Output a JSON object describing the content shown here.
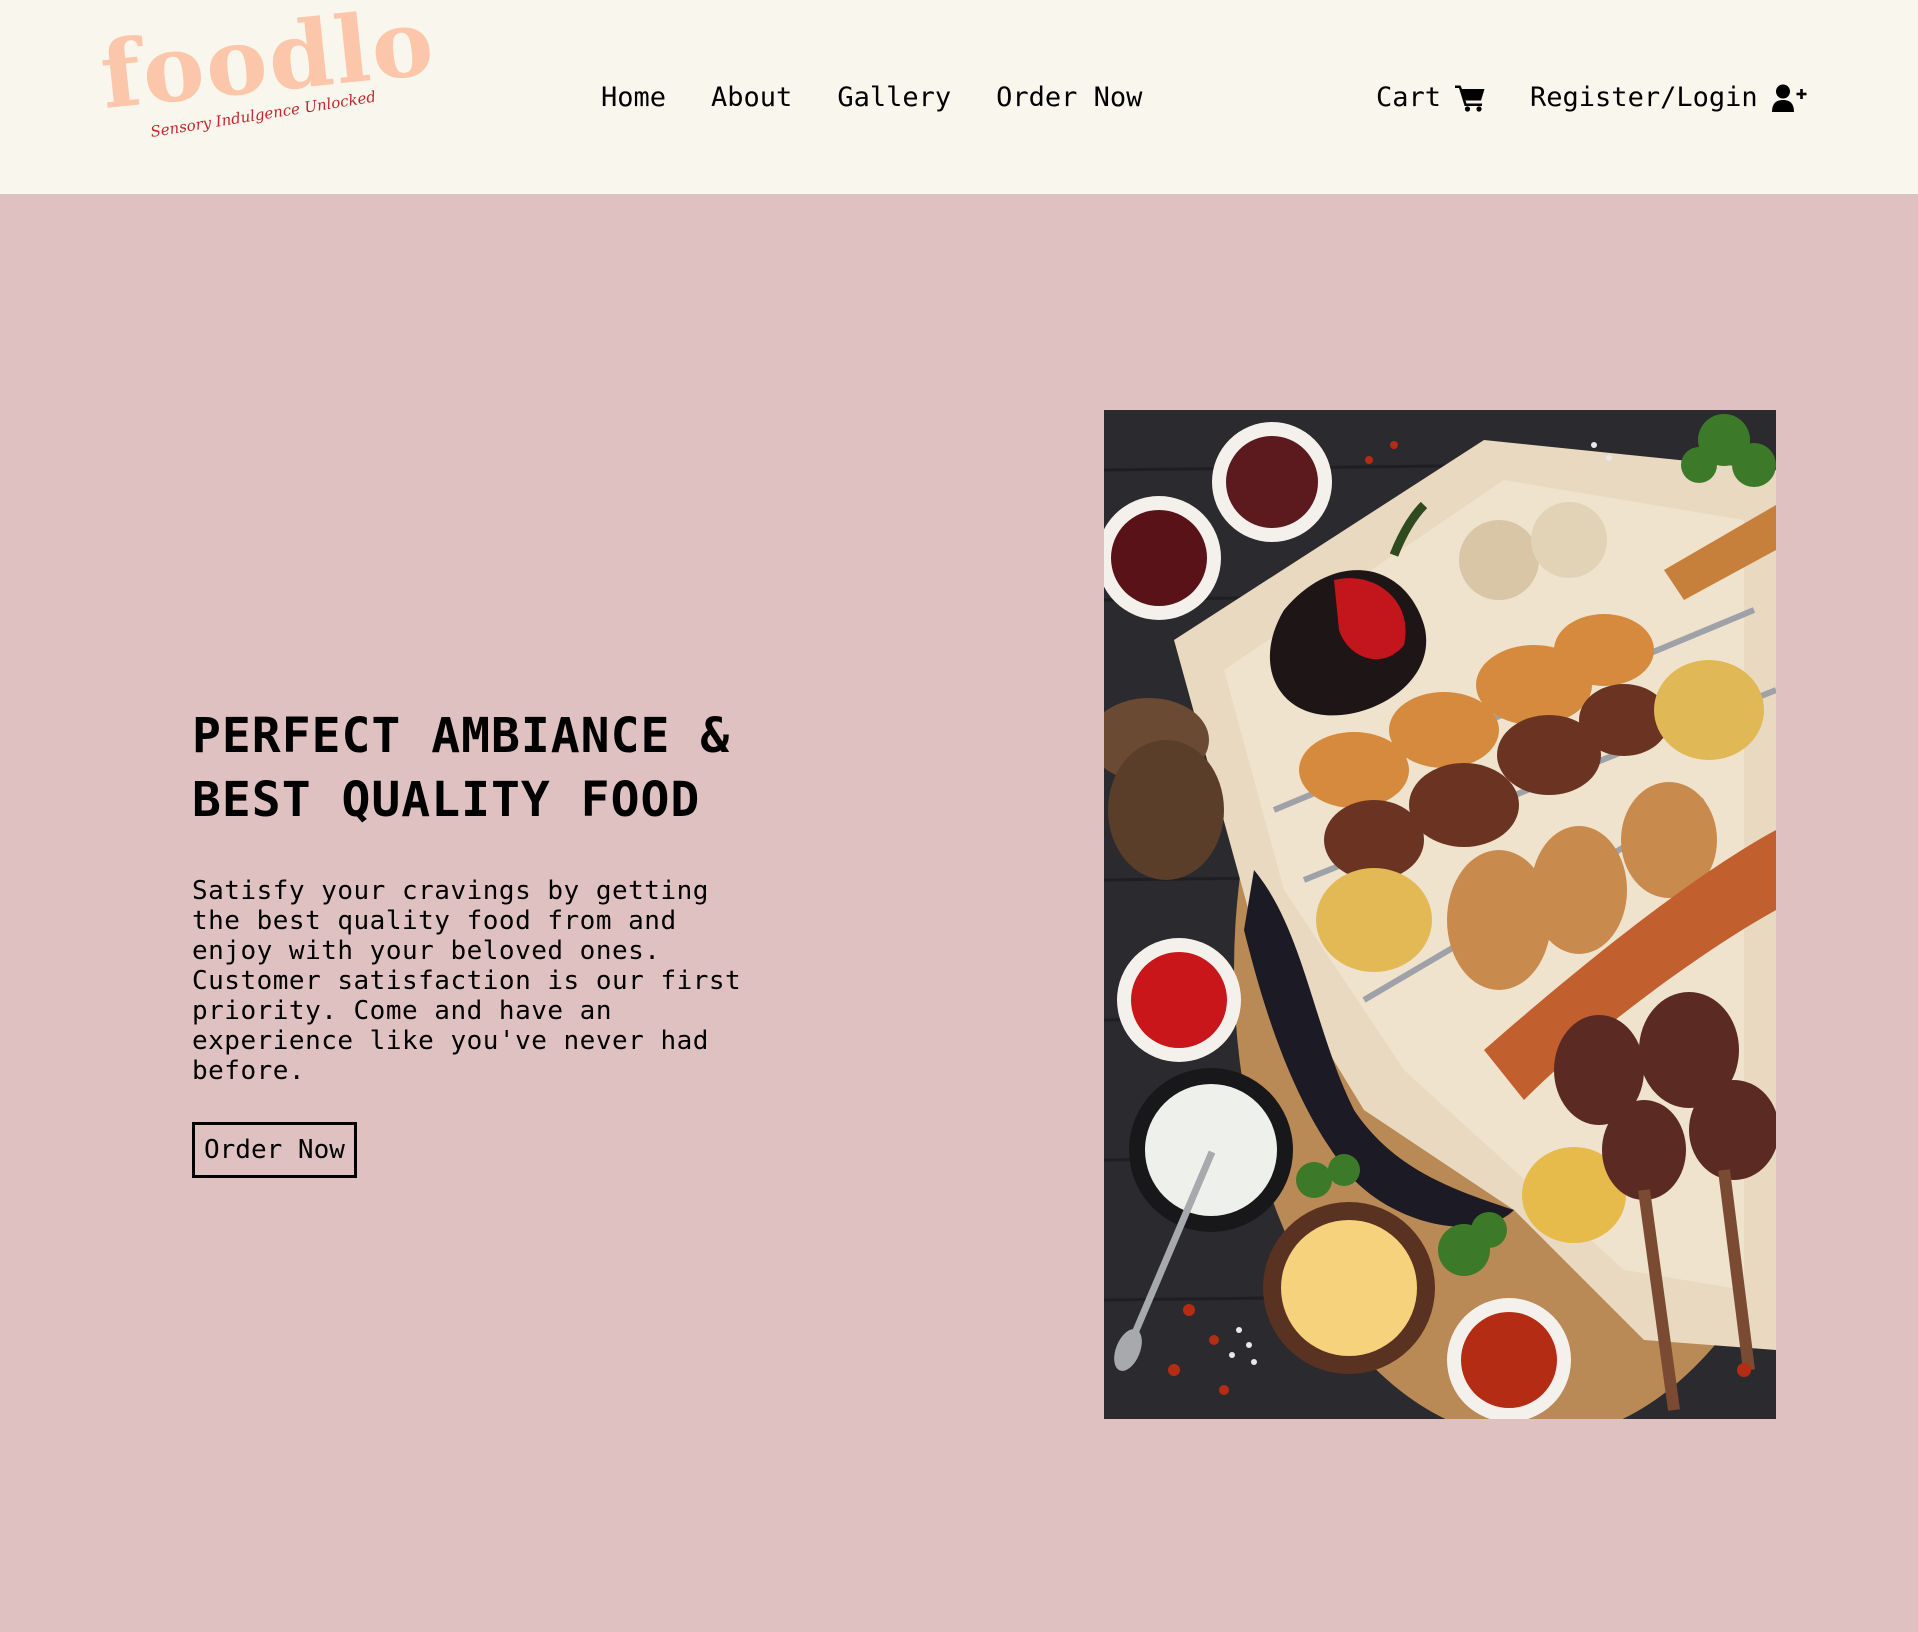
{
  "brand": {
    "name": "foodlo",
    "tagline": "Sensory Indulgence Unlocked"
  },
  "nav": {
    "items": [
      {
        "label": "Home"
      },
      {
        "label": "About"
      },
      {
        "label": "Gallery"
      },
      {
        "label": "Order Now"
      }
    ],
    "cart_label": "Cart",
    "cart_icon": "shopping-cart-icon",
    "account_label": "Register/Login",
    "account_icon": "user-plus-icon"
  },
  "hero": {
    "title": "PERFECT AMBIANCE & BEST QUALITY FOOD",
    "description": "Satisfy your cravings by getting the best quality food from and enjoy with your beloved ones. Customer satisfaction is our first priority. Come and have an experience like you've never had before.",
    "button_label": "Order Now"
  },
  "image": {
    "alt": "Platter of grilled kebabs, vegetables and dipping sauces"
  },
  "colors": {
    "header_bg": "#f9f6ee",
    "hero_bg": "#dfc1c2",
    "logo": "#fcc6aa",
    "tagline": "#c1272d",
    "text": "#000000"
  }
}
